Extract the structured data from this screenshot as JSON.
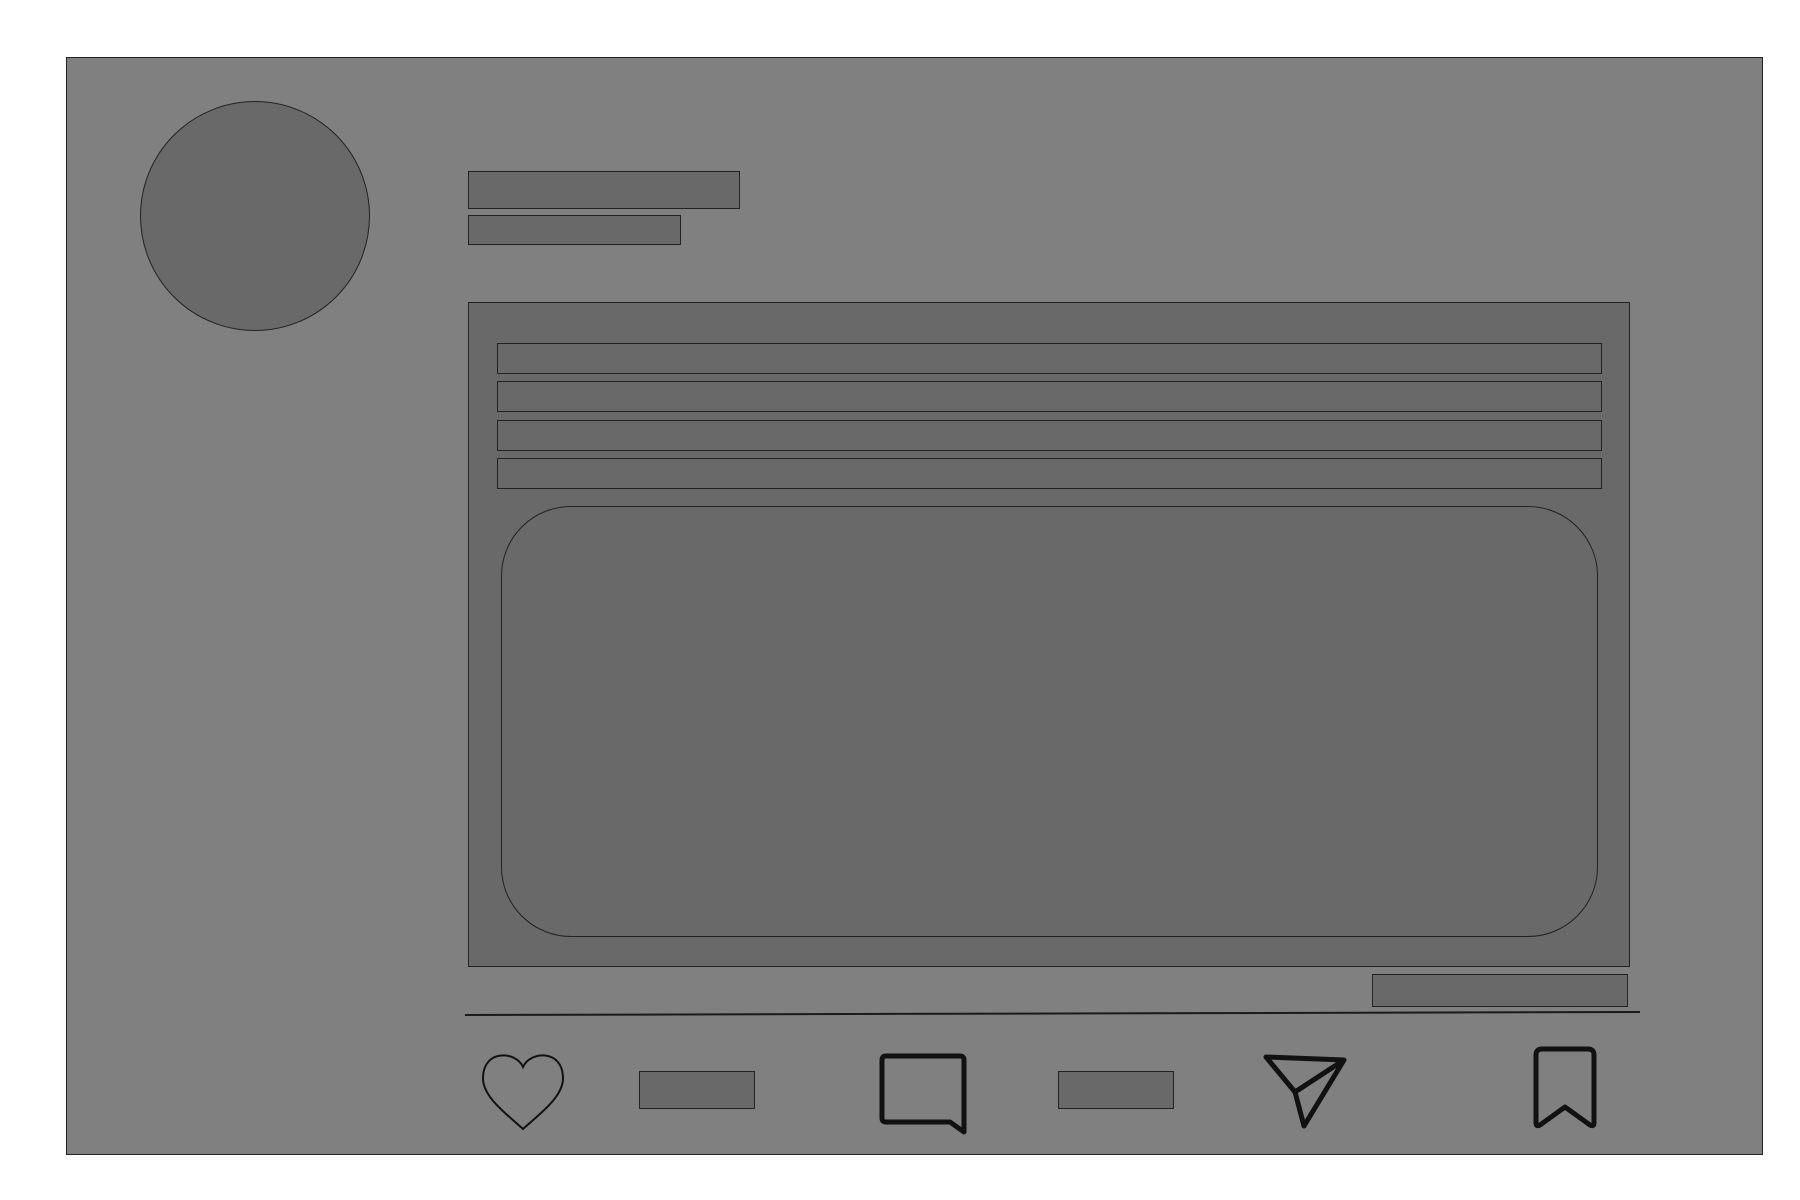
{
  "post": {
    "author_name": "",
    "author_handle": "",
    "body_lines": [
      "",
      "",
      "",
      ""
    ],
    "timestamp": "",
    "likes_count": "",
    "comments_count": ""
  },
  "icons": {
    "like": "heart-icon",
    "comment": "speech-bubble-icon",
    "share": "paper-plane-icon",
    "bookmark": "bookmark-icon"
  },
  "colors": {
    "card_background": "#808080",
    "placeholder_fill": "#696969",
    "stroke": "#1a1a1a"
  }
}
